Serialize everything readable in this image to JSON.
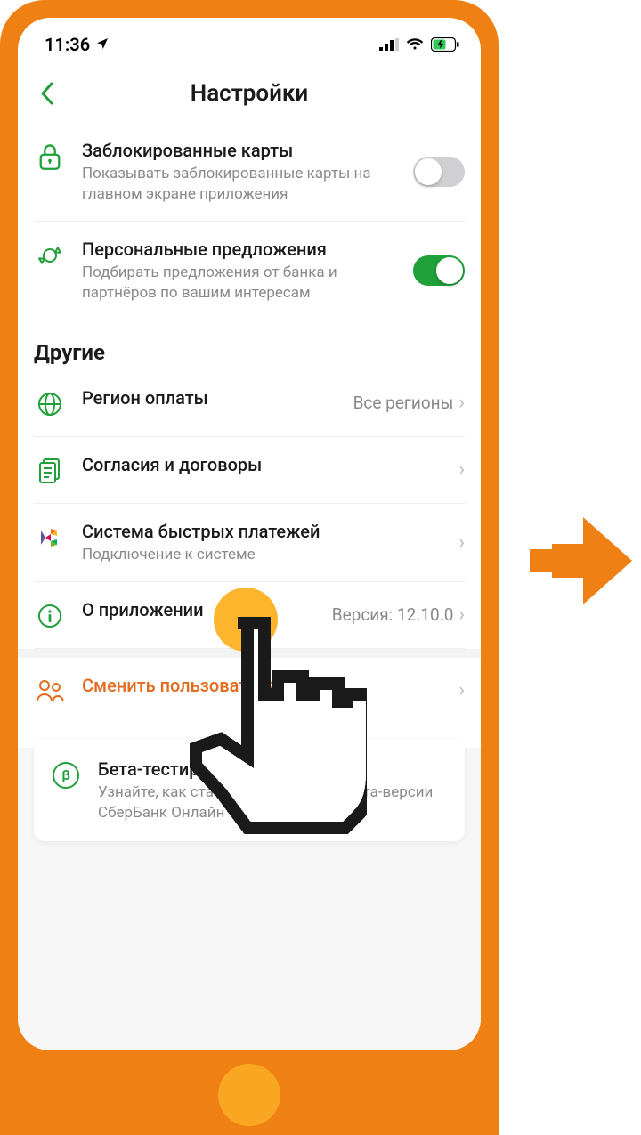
{
  "status": {
    "time": "11:36",
    "location_icon": "location-icon",
    "signal_icon": "signal-icon",
    "wifi_icon": "wifi-icon",
    "battery_icon": "battery-charging-icon"
  },
  "header": {
    "back_icon": "chevron-left-icon",
    "title": "Настройки"
  },
  "settings": {
    "blocked_cards": {
      "icon": "lock-icon",
      "title": "Заблокированные карты",
      "subtitle": "Показывать заблокированные карты на главном экране приложения",
      "enabled": false
    },
    "personal_offers": {
      "icon": "candy-icon",
      "title": "Персональные предложения",
      "subtitle": "Подбирать предложения от банка и партнёров по вашим интересам",
      "enabled": true
    }
  },
  "other_section": {
    "title": "Другие",
    "items": [
      {
        "icon": "globe-icon",
        "title": "Регион оплаты",
        "value": "Все регионы"
      },
      {
        "icon": "documents-icon",
        "title": "Согласия и договоры"
      },
      {
        "icon": "sbp-icon",
        "title": "Система быстрых платежей",
        "subtitle": "Подключение к системе"
      },
      {
        "icon": "info-icon",
        "title": "О приложении",
        "value": "Версия: 12.10.0"
      }
    ]
  },
  "change_user": {
    "icon": "users-icon",
    "title": "Сменить пользователя"
  },
  "beta_card": {
    "icon": "beta-icon",
    "title": "Бета-тестирование",
    "subtitle": "Узнайте, как стать пользователем бета-версии СберБанк Онлайн"
  },
  "colors": {
    "frame": "#ef8014",
    "accent_green": "#1fa038",
    "accent_orange": "#e36b1e",
    "tap_highlight": "#fcb52d"
  }
}
